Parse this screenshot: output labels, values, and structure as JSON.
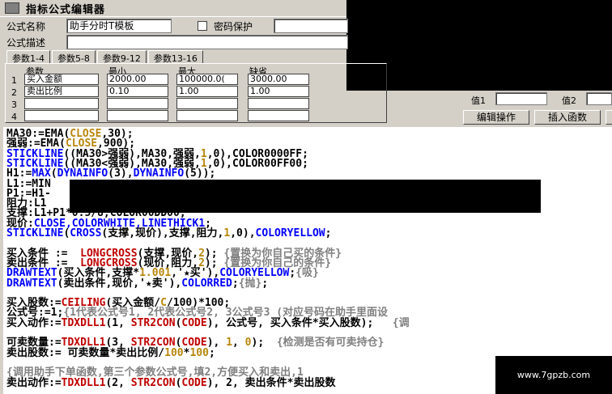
{
  "window": {
    "title": "指标公式编辑器"
  },
  "form": {
    "name_label": "公式名称",
    "name_value": "助手分时T模板",
    "password_label": "密码保护",
    "desc_label": "公式描述"
  },
  "tabs": [
    "参数1-4",
    "参数5-8",
    "参数9-12",
    "参数13-16"
  ],
  "params": {
    "headers": [
      "参数",
      "最小",
      "最大",
      "缺省"
    ],
    "rows": [
      {
        "n": "1",
        "name": "买入金额",
        "min": "2000.00",
        "max": "100000.0(",
        "def": "3000.00"
      },
      {
        "n": "2",
        "name": "卖出比例",
        "min": "0.10",
        "max": "1.00",
        "def": "1.00"
      },
      {
        "n": "3",
        "name": "",
        "min": "",
        "max": "",
        "def": ""
      },
      {
        "n": "4",
        "name": "",
        "min": "",
        "max": "",
        "def": ""
      }
    ]
  },
  "right": {
    "value1_label": "值1",
    "value2_label": "值2",
    "edit_button": "编辑操作",
    "insert_fn_button": "插入函数"
  },
  "code_lines": [
    [
      [
        "MA30:=EMA(",
        "#000"
      ],
      [
        "CLOSE",
        "#b8860b"
      ],
      [
        ",30);",
        "#000"
      ]
    ],
    [
      [
        "强弱:=EMA(",
        "#000"
      ],
      [
        "CLOSE",
        "#b8860b"
      ],
      [
        ",900);",
        "#000"
      ]
    ],
    [
      [
        "STICKLINE",
        "#0000ff"
      ],
      [
        "((MA30>强弱),MA30,强弱,",
        "#000"
      ],
      [
        "1",
        "#b8860b"
      ],
      [
        ",0),COLOR0000FF;",
        "#000"
      ]
    ],
    [
      [
        "STICKLINE",
        "#0000ff"
      ],
      [
        "((MA30<强弱),MA30,强弱,",
        "#000"
      ],
      [
        "1",
        "#b8860b"
      ],
      [
        ",0),COLOR00FF00;",
        "#000"
      ]
    ],
    [
      [
        "H1:=",
        "#000"
      ],
      [
        "MAX",
        "#0000ff"
      ],
      [
        "(",
        "#000"
      ],
      [
        "DYNAINFO",
        "#0000ff"
      ],
      [
        "(3),",
        "#000"
      ],
      [
        "DYNAINFO",
        "#0000ff"
      ],
      [
        "(5));",
        "#000"
      ]
    ],
    [
      [
        "L1:=MIN",
        "#000"
      ]
    ],
    [
      [
        "P1:=H1-",
        "#000"
      ]
    ],
    [
      [
        "阻力:L1",
        "#000"
      ]
    ],
    [
      [
        "支撑:L1+P1*0.5/8,COLOR00DD00;",
        "#000"
      ]
    ],
    [
      [
        "现价:",
        "#000"
      ],
      [
        "CLOSE,COLORWHITE,LINETHICK1",
        "#0000ff"
      ],
      [
        ";",
        "#000"
      ]
    ],
    [
      [
        "STICKLINE",
        "#0000ff"
      ],
      [
        "(",
        "#000"
      ],
      [
        "CROSS",
        "#0000ff"
      ],
      [
        "(支撑,现价),支撑,阻力,",
        "#000"
      ],
      [
        "1",
        "#b8860b"
      ],
      [
        ",0),",
        "#000"
      ],
      [
        "COLORYELLOW",
        "#0000ff"
      ],
      [
        ";",
        "#000"
      ]
    ],
    [
      [
        "",
        "#000"
      ]
    ],
    [
      [
        "买入条件 :=  ",
        "#000"
      ],
      [
        "LONGCROSS",
        "#c00000"
      ],
      [
        "(支撑,现价,",
        "#000"
      ],
      [
        "2",
        "#b8860b"
      ],
      [
        ");",
        "#000"
      ],
      [
        " {置换为你自己买的条件}",
        "#808080"
      ]
    ],
    [
      [
        "卖出条件 :=  ",
        "#000"
      ],
      [
        "LONGCROSS",
        "#c00000"
      ],
      [
        "(现价,阻力,",
        "#000"
      ],
      [
        "2",
        "#b8860b"
      ],
      [
        ");",
        "#000"
      ],
      [
        " {置换为你自己的条件}",
        "#808080"
      ]
    ],
    [
      [
        "DRAWTEXT",
        "#0000ff"
      ],
      [
        "(买入条件,支撑*",
        "#000"
      ],
      [
        "1.001",
        "#b8860b"
      ],
      [
        ",'★买'),",
        "#000"
      ],
      [
        "COLORYELLOW",
        "#0000ff"
      ],
      [
        ";",
        "#000"
      ],
      [
        "{吸}",
        "#808080"
      ]
    ],
    [
      [
        "DRAWTEXT",
        "#0000ff"
      ],
      [
        "(卖出条件,现价,'★卖'),",
        "#000"
      ],
      [
        "COLORRED",
        "#0000ff"
      ],
      [
        ";",
        "#000"
      ],
      [
        "{抛}",
        "#808080"
      ],
      [
        ";",
        "#000"
      ]
    ],
    [
      [
        "",
        "#000"
      ]
    ],
    [
      [
        "买入股数:=",
        "#000"
      ],
      [
        "CEILING",
        "#c00000"
      ],
      [
        "(买入金额/",
        "#000"
      ],
      [
        "C",
        "#b8860b"
      ],
      [
        "/100)*100;",
        "#000"
      ]
    ],
    [
      [
        "公式号:=1;",
        "#000"
      ],
      [
        "{1代表公式号1, 2代表公式号2, 3公式号3 (对应号码在助手里面设",
        "#808080"
      ]
    ],
    [
      [
        "买入动作:=",
        "#000"
      ],
      [
        "TDXDLL1",
        "#c00000"
      ],
      [
        "(1, ",
        "#000"
      ],
      [
        "STR2CON",
        "#c00000"
      ],
      [
        "(",
        "#000"
      ],
      [
        "CODE",
        "#c00000"
      ],
      [
        "), 公式号, 买入条件*买入股数);   ",
        "#000"
      ],
      [
        "{调",
        "#808080"
      ]
    ],
    [
      [
        "",
        "#000"
      ]
    ],
    [
      [
        "可卖数量:=",
        "#000"
      ],
      [
        "TDXDLL1",
        "#c00000"
      ],
      [
        "(3, ",
        "#000"
      ],
      [
        "STR2CON",
        "#c00000"
      ],
      [
        "(",
        "#000"
      ],
      [
        "CODE",
        "#c00000"
      ],
      [
        "), ",
        "#000"
      ],
      [
        "1",
        "#b8860b"
      ],
      [
        ", ",
        "#000"
      ],
      [
        "0",
        "#b8860b"
      ],
      [
        ");  ",
        "#000"
      ],
      [
        "{检测是否有可卖持仓}",
        "#808080"
      ]
    ],
    [
      [
        "卖出股数:= 可卖数量*卖出比例/",
        "#000"
      ],
      [
        "100",
        "#b8860b"
      ],
      [
        "*",
        "#000"
      ],
      [
        "100",
        "#b8860b"
      ],
      [
        ";",
        "#000"
      ]
    ],
    [
      [
        "",
        "#000"
      ]
    ],
    [
      [
        "{调用助手下单函数,第三个参数公式号,填2,方便买入和卖出,1",
        "#808080"
      ]
    ],
    [
      [
        "卖出动作:=",
        "#000"
      ],
      [
        "TDXDLL1",
        "#c00000"
      ],
      [
        "(2, ",
        "#000"
      ],
      [
        "STR2CON",
        "#c00000"
      ],
      [
        "(",
        "#000"
      ],
      [
        "CODE",
        "#c00000"
      ],
      [
        "), 2, 卖出条件*卖出股数",
        "#000"
      ]
    ]
  ],
  "watermark": "www.7gpzb.com"
}
